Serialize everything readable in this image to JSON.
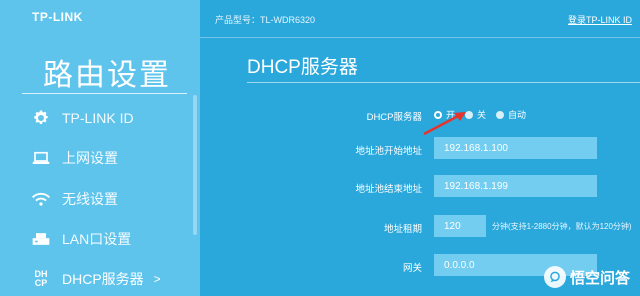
{
  "brand": {
    "logo": "TP-LINK"
  },
  "header": {
    "model_label": "产品型号：TL-WDR6320",
    "logout": "登录TP-LINK ID"
  },
  "sidebar": {
    "title": "路由设置",
    "items": [
      {
        "label": "TP-LINK ID",
        "icon": "gear-icon"
      },
      {
        "label": "上网设置",
        "icon": "laptop-icon"
      },
      {
        "label": "无线设置",
        "icon": "wifi-icon"
      },
      {
        "label": "LAN口设置",
        "icon": "router-icon"
      },
      {
        "label": "DHCP服务器",
        "icon": "dhcp-icon",
        "active": true,
        "chevron": ">",
        "icon_text_top": "DH",
        "icon_text_bottom": "CP"
      }
    ]
  },
  "main": {
    "title": "DHCP服务器",
    "dhcp": {
      "label": "DHCP服务器",
      "options": [
        "开",
        "关",
        "自动"
      ],
      "selected": "开"
    },
    "pool_start": {
      "label": "地址池开始地址",
      "value": "192.168.1.100"
    },
    "pool_end": {
      "label": "地址池结束地址",
      "value": "192.168.1.199"
    },
    "lease": {
      "label": "地址租期",
      "value": "120",
      "hint": "分钟(支持1-2880分钟，默认为120分钟)"
    },
    "gateway": {
      "label": "网关",
      "value": "0.0.0.0"
    }
  },
  "watermark": {
    "text": "悟空问答"
  },
  "colors": {
    "background": "#2aa8dc",
    "sidebar": "#5fc4ec",
    "field": "#73cdf0",
    "arrow": "#e8322c"
  }
}
